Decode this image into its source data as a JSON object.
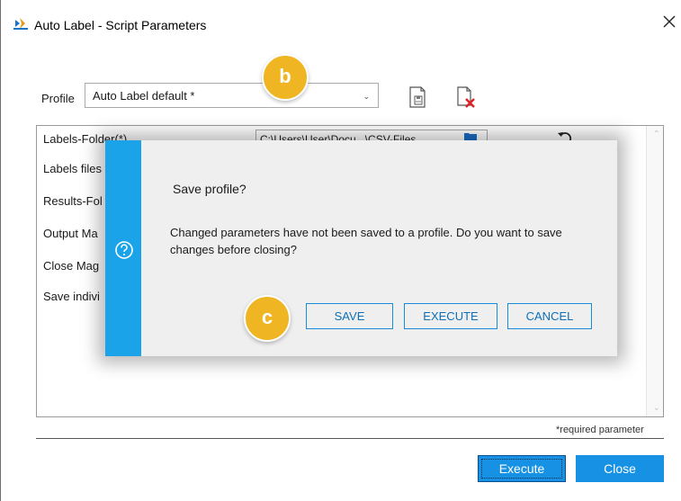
{
  "window": {
    "title": "Auto Label - Script Parameters",
    "icon": "app-logo-icon",
    "close_icon": "close-icon"
  },
  "profile": {
    "label": "Profile",
    "selected": "Auto Label default *",
    "save_icon": "save-profile-icon",
    "delete_icon": "delete-profile-icon"
  },
  "parameters": {
    "rows": [
      {
        "label": "Labels-Folder(*)",
        "value": "C:\\Users\\User\\Docu...\\CSV-Files"
      },
      {
        "label": "Labels files"
      },
      {
        "label": "Results-Fol"
      },
      {
        "label": "Output Ma"
      },
      {
        "label": "Close Mag"
      },
      {
        "label": "Save indivi"
      }
    ],
    "required_note": "*required parameter"
  },
  "footer": {
    "execute_label": "Execute",
    "close_label": "Close"
  },
  "dialog": {
    "title": "Save profile?",
    "message": "Changed parameters have not been saved to a profile. Do you want to save changes before closing?",
    "icon": "help-icon",
    "buttons": {
      "save": "SAVE",
      "execute": "EXECUTE",
      "cancel": "CANCEL"
    }
  },
  "callouts": {
    "b": "b",
    "c": "c"
  },
  "colors": {
    "accent": "#1791e3",
    "dialog_stripe": "#1aa3e8",
    "callout": "#f0b523",
    "dialog_bg": "#efefef"
  }
}
